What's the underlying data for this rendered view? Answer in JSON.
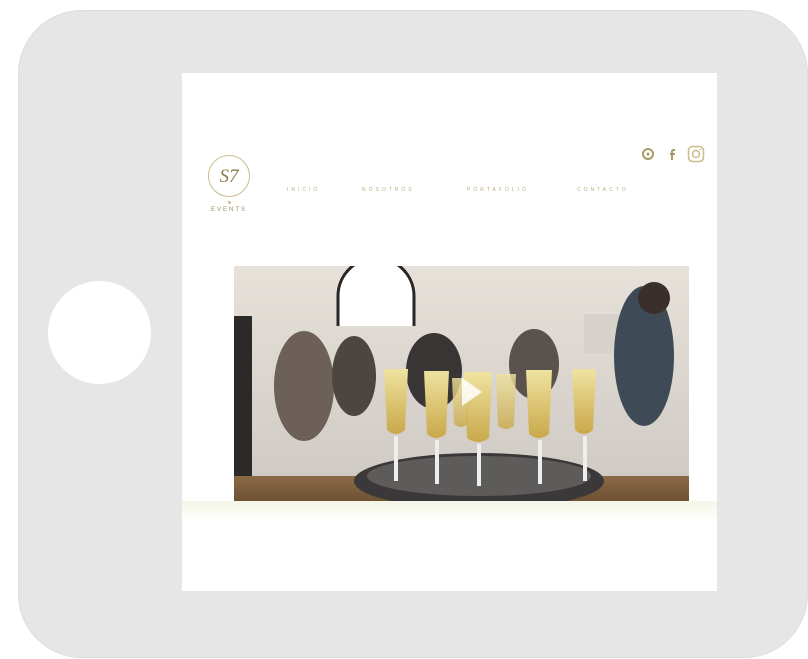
{
  "device": {
    "type": "tablet",
    "frame_color": "#e6e6e6",
    "home_button_color": "#ffffff"
  },
  "site": {
    "logo": {
      "mark": "S7",
      "subtitle": "EVENTS"
    },
    "nav": [
      {
        "label": "INICIO"
      },
      {
        "label": "NOSOTROS"
      },
      {
        "label": "PORTAFOLIO"
      },
      {
        "label": "CONTACTO"
      }
    ],
    "socials": [
      {
        "icon": "tripadvisor-icon"
      },
      {
        "icon": "facebook-icon"
      },
      {
        "icon": "instagram-icon"
      }
    ],
    "accent_color": "#c9bd8a",
    "hero": {
      "description": "Champagne flutes on a tray at an event",
      "tones": [
        "#e8e4df",
        "#c9bd8a",
        "#5a4a2e",
        "#2e2a28"
      ]
    }
  }
}
